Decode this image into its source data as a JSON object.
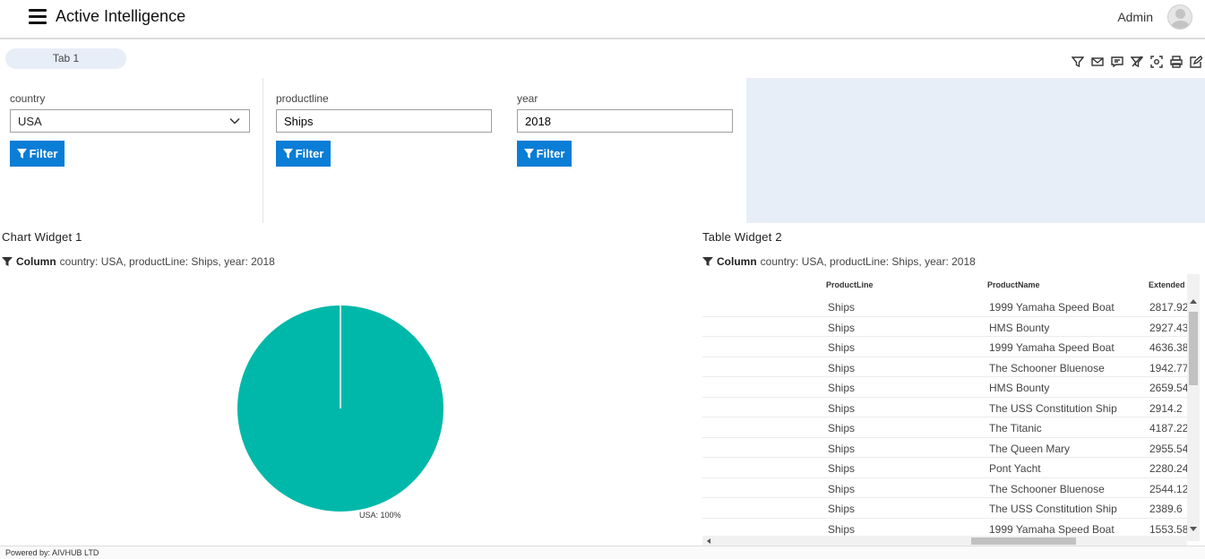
{
  "header": {
    "title": "Active Intelligence",
    "user": "Admin"
  },
  "tabs": [
    {
      "label": "Tab 1"
    }
  ],
  "toolbar": {
    "icons": [
      "filter-icon",
      "mail-icon",
      "comment-icon",
      "clear-filter-icon",
      "screenshot-icon",
      "print-icon",
      "edit-icon"
    ]
  },
  "filters": [
    {
      "label": "country",
      "value": "USA",
      "button": "Filter"
    },
    {
      "label": "productline",
      "value": "Ships",
      "button": "Filter"
    },
    {
      "label": "year",
      "value": "2018",
      "button": "Filter"
    }
  ],
  "chart_widget": {
    "title": "Chart Widget 1",
    "sub_bold": "Column",
    "sub_text": "country: USA, productLine: Ships, year: 2018",
    "legend": "USA: 100%"
  },
  "chart_data": {
    "type": "pie",
    "categories": [
      "USA"
    ],
    "values": [
      100
    ],
    "colors": [
      "#00b8a9"
    ]
  },
  "table_widget": {
    "title": "Table Widget 2",
    "sub_bold": "Column",
    "sub_text": "country: USA, productLine: Ships, year: 2018",
    "columns": [
      "ProductLine",
      "ProductName",
      "Extended"
    ],
    "rows": [
      [
        "Ships",
        "1999 Yamaha Speed Boat",
        "2817.92"
      ],
      [
        "Ships",
        "HMS Bounty",
        "2927.43"
      ],
      [
        "Ships",
        "1999 Yamaha Speed Boat",
        "4636.38"
      ],
      [
        "Ships",
        "The Schooner Bluenose",
        "1942.77"
      ],
      [
        "Ships",
        "HMS Bounty",
        "2659.54"
      ],
      [
        "Ships",
        "The USS Constitution Ship",
        "2914.2"
      ],
      [
        "Ships",
        "The Titanic",
        "4187.22"
      ],
      [
        "Ships",
        "The Queen Mary",
        "2955.54"
      ],
      [
        "Ships",
        "Pont Yacht",
        "2280.24"
      ],
      [
        "Ships",
        "The Schooner Bluenose",
        "2544.12"
      ],
      [
        "Ships",
        "The USS Constitution Ship",
        "2389.6"
      ],
      [
        "Ships",
        "1999 Yamaha Speed Boat",
        "1553.58"
      ]
    ]
  },
  "footer": {
    "text": "Powered by: AIVHUB LTD"
  }
}
